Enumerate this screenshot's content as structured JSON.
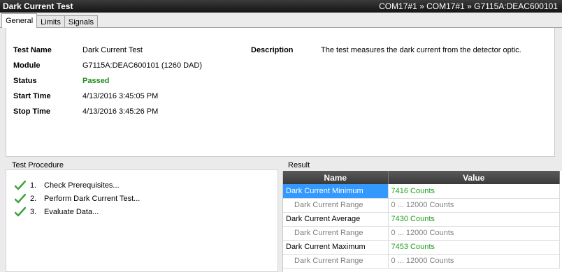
{
  "title": "Dark Current Test",
  "breadcrumb": "COM17#1 » COM17#1 » G7115A:DEAC600101",
  "tabs": [
    "General",
    "Limits",
    "Signals"
  ],
  "info": {
    "test_name_label": "Test Name",
    "test_name_value": "Dark Current Test",
    "module_label": "Module",
    "module_value": "G7115A:DEAC600101 (1260 DAD)",
    "status_label": "Status",
    "status_value": "Passed",
    "start_label": "Start Time",
    "start_value": "4/13/2016 3:45:05 PM",
    "stop_label": "Stop Time",
    "stop_value": "4/13/2016 3:45:26 PM",
    "description_label": "Description",
    "description_value": "The test measures the dark current from the detector optic."
  },
  "procedure": {
    "title": "Test Procedure",
    "steps": [
      {
        "num": "1.",
        "label": "Check Prerequisites...",
        "icon": "green-check-icon"
      },
      {
        "num": "2.",
        "label": "Perform Dark Current Test...",
        "icon": "green-check-icon"
      },
      {
        "num": "3.",
        "label": "Evaluate Data...",
        "icon": "green-check-icon"
      }
    ]
  },
  "result": {
    "title": "Result",
    "columns": [
      "Name",
      "Value"
    ],
    "rows": [
      {
        "name": "Dark Current Minimum",
        "value": "7416 Counts"
      },
      {
        "name": "Dark Current Range",
        "value": "0 ... 12000 Counts"
      },
      {
        "name": "Dark Current Average",
        "value": "7430 Counts"
      },
      {
        "name": "Dark Current Range",
        "value": "0 ... 12000 Counts"
      },
      {
        "name": "Dark Current Maximum",
        "value": "7453 Counts"
      },
      {
        "name": "Dark Current Range",
        "value": "0 ... 12000 Counts"
      }
    ]
  },
  "colors": {
    "passed": "#1f8c1f",
    "value_green": "#20a020",
    "selection": "#3399ff",
    "header_dark": "#3a3a3a"
  }
}
